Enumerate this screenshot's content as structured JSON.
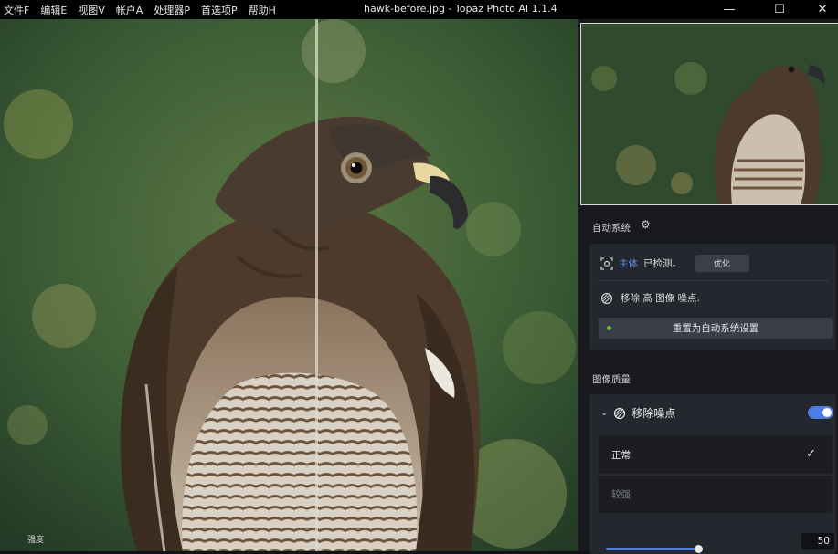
{
  "menu": [
    "文件F",
    "编辑E",
    "视图V",
    "帐户A",
    "处理器P",
    "首选项P",
    "帮助H"
  ],
  "window": {
    "title": "hawk-before.jpg - Topaz Photo AI 1.1.4",
    "minimize": "—",
    "maximize": "☐",
    "close": "✕"
  },
  "autopilot": {
    "label": "自动系统",
    "subject_word": "主体",
    "subject_status": "已检测。",
    "optimize_label": "优化",
    "denoise_hint": "移除 高 图像 噪点.",
    "reset_label": "重置为自动系统设置"
  },
  "quality": {
    "label": "图像质量",
    "denoise": {
      "title": "移除噪点",
      "enabled": true,
      "options": [
        "正常",
        "较强"
      ],
      "selected": "正常",
      "strength_label": "强度",
      "strength_value": "50"
    }
  },
  "colors": {
    "accent": "#4f7de3",
    "subject_link": "#5b8de8",
    "status_dot": "#6cbf3f"
  }
}
